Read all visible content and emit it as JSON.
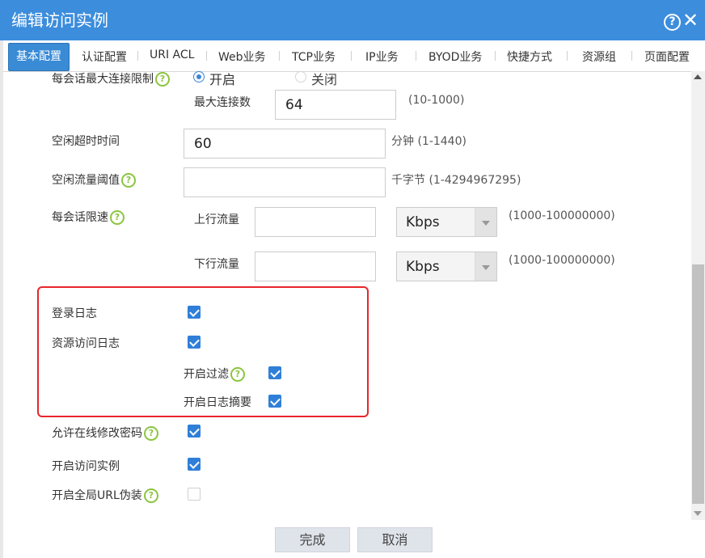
{
  "window": {
    "title": "编辑访问实例",
    "help_icon": "help-icon",
    "close_icon": "close-icon"
  },
  "tabs": [
    {
      "label": "基本配置",
      "active": true
    },
    {
      "label": "认证配置"
    },
    {
      "label": "URI ACL"
    },
    {
      "label": "Web业务"
    },
    {
      "label": "TCP业务"
    },
    {
      "label": "IP业务"
    },
    {
      "label": "BYOD业务"
    },
    {
      "label": "快捷方式"
    },
    {
      "label": "资源组"
    },
    {
      "label": "页面配置"
    }
  ],
  "form": {
    "max_conn": {
      "label": "每会话最大连接限制",
      "radio_on": "开启",
      "radio_off": "关闭",
      "selected": "开启",
      "sub_label": "最大连接数",
      "value": "64",
      "hint": "(10-1000)"
    },
    "idle_timeout": {
      "label": "空闲超时时间",
      "value": "60",
      "hint": "分钟  (1-1440)"
    },
    "idle_threshold": {
      "label": "空闲流量阈值",
      "value": "",
      "hint": "千字节  (1-4294967295)"
    },
    "rate_limit": {
      "label": "每会话限速",
      "upstream_label": "上行流量",
      "upstream_value": "",
      "upstream_unit": "Kbps",
      "upstream_hint": "(1000-100000000)",
      "downstream_label": "下行流量",
      "downstream_value": "",
      "downstream_unit": "Kbps",
      "downstream_hint": "(1000-100000000)"
    },
    "login_log": {
      "label": "登录日志",
      "checked": true
    },
    "resource_log": {
      "label": "资源访问日志",
      "checked": true
    },
    "enable_filter": {
      "label": "开启过滤",
      "checked": true
    },
    "enable_summary": {
      "label": "开启日志摘要",
      "checked": true
    },
    "allow_pwd_change": {
      "label": "允许在线修改密码",
      "checked": true
    },
    "enable_instance": {
      "label": "开启访问实例",
      "checked": true
    },
    "url_disguise": {
      "label": "开启全局URL伪装",
      "checked": false
    }
  },
  "buttons": {
    "ok": "完成",
    "cancel": "取消"
  },
  "colors": {
    "titlebar": "#3c8ddc",
    "active_tab": "#3a8bd5",
    "checkbox": "#2f7fd8",
    "help": "#8bc53f",
    "highlight": "#e8262b"
  }
}
